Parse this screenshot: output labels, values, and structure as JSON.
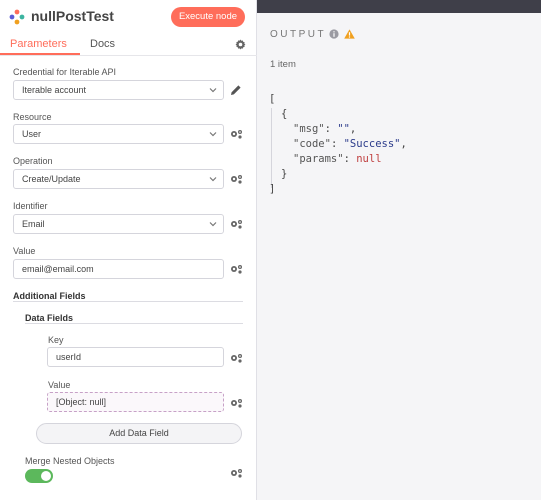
{
  "node": {
    "title": "nullPostTest",
    "execute_label": "Execute node"
  },
  "tabs": {
    "parameters": "Parameters",
    "docs": "Docs"
  },
  "fields": {
    "credential": {
      "label": "Credential for Iterable API",
      "value": "Iterable account"
    },
    "resource": {
      "label": "Resource",
      "value": "User"
    },
    "operation": {
      "label": "Operation",
      "value": "Create/Update"
    },
    "identifier": {
      "label": "Identifier",
      "value": "Email"
    },
    "value": {
      "label": "Value",
      "value": "email@email.com"
    }
  },
  "additional_fields": {
    "title": "Additional Fields",
    "data_fields": {
      "title": "Data Fields",
      "key_label": "Key",
      "key_value": "userId",
      "value_label": "Value",
      "value_value": "[Object: null]",
      "add_label": "Add Data Field"
    },
    "merge_nested": {
      "label": "Merge Nested Objects",
      "enabled": true
    }
  },
  "output": {
    "title": "OUTPUT",
    "items_count": "1 item",
    "json_lines": {
      "l1": "[",
      "l2": "{",
      "l3_key": "\"msg\"",
      "l3_sep": ": ",
      "l3_val": "\"\"",
      "l3_end": ",",
      "l4_key": "\"code\"",
      "l4_sep": ": ",
      "l4_val": "\"Success\"",
      "l4_end": ",",
      "l5_key": "\"params\"",
      "l5_sep": ": ",
      "l5_val": "null",
      "l6": "}",
      "l7": "]"
    }
  },
  "colors": {
    "accent": "#ff6d5a",
    "toggle_on": "#5cb85c",
    "topbar": "#3f3f49",
    "warning": "#f0a020"
  },
  "icons": [
    "node-logo-icon",
    "settings-icon",
    "chevron-down-icon",
    "pencil-icon",
    "parameter-options-icon",
    "info-icon",
    "warning-icon"
  ]
}
